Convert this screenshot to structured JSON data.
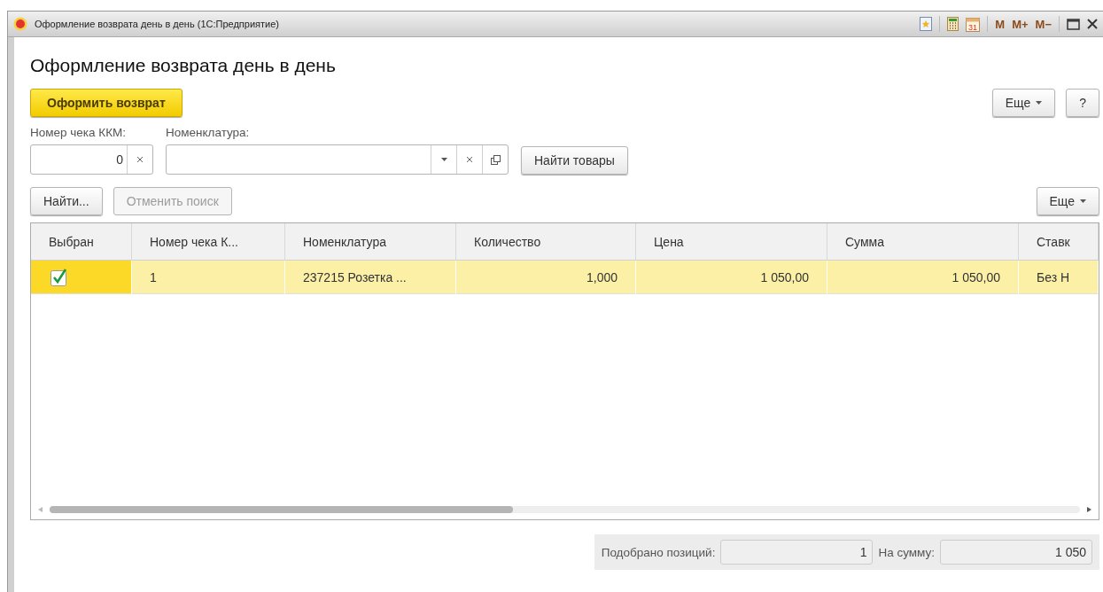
{
  "window": {
    "title": "Оформление возврата день в день  (1С:Предприятие)",
    "calendar_day": "31",
    "memory_buttons": [
      "M",
      "M+",
      "M−"
    ]
  },
  "form_title": "Оформление возврата день в день",
  "toolbar": {
    "primary": "Оформить возврат",
    "more": "Еще",
    "help": "?"
  },
  "fields": [
    {
      "label": "Номер чека ККМ:",
      "value": "0",
      "kind": "number"
    },
    {
      "label": "Номенклатура:",
      "kind": "choice"
    }
  ],
  "find_goods": "Найти товары",
  "table_toolbar": {
    "buttons": [
      {
        "label": "Найти...",
        "disabled": false
      },
      {
        "label": "Отменить поиск",
        "disabled": true
      }
    ],
    "more": "Еще"
  },
  "table": {
    "columns": [
      "Выбран",
      "Номер чека К...",
      "Номенклатура",
      "Количество",
      "Цена",
      "Сумма",
      "Ставк"
    ],
    "rows": [
      {
        "selected": true,
        "checked": true,
        "cells": [
          "",
          "1",
          "237215 Розетка ...",
          "1,000",
          "1 050,00",
          "1 050,00",
          "Без Н"
        ]
      }
    ]
  },
  "footer": {
    "positions_label": "Подобрано позиций:",
    "positions": "1",
    "sum_label": "На сумму:",
    "sum": "1 050"
  }
}
